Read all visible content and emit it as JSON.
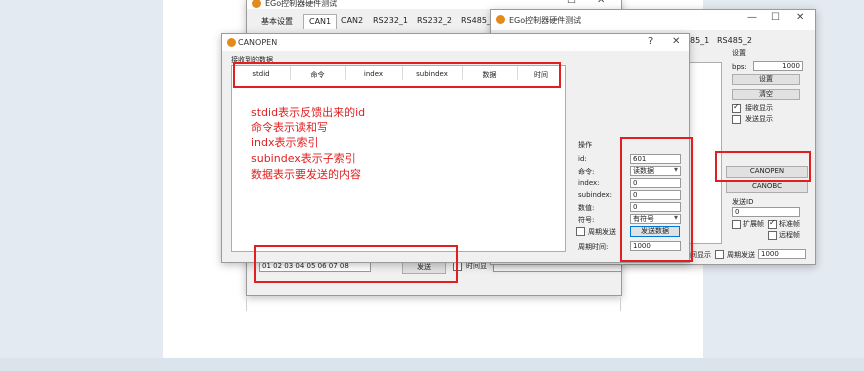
{
  "back_window": {
    "title": "EGo控制器硬件测试",
    "tabs": [
      "基本设置",
      "CAN1",
      "CAN2",
      "RS232_1",
      "RS232_2",
      "RS485_1"
    ],
    "data_input_value": "01 02 03 04 05 06 07 08",
    "send_label": "发送",
    "time_label": "时间显"
  },
  "right_window": {
    "title": "EGo控制器硬件测试",
    "tabs_partial": [
      "85_1",
      "RS485_2"
    ],
    "settings_label": "设置",
    "bps_label": "bps:",
    "bps_value": "1000",
    "set_button": "设置",
    "clear_button": "清空",
    "recv_show_label": "接收显示",
    "send_show_label": "发送显示",
    "canopen_button": "CANOPEN",
    "canobc_button": "CANOBC",
    "send_id_label": "发送ID",
    "send_id_value": "0",
    "ext_frame_label": "扩展帧",
    "std_frame_label": "标准帧",
    "remote_frame_label": "远程帧",
    "show_partial": "间显示",
    "periodic_send_label": "周期发送",
    "periodic_value": "1000"
  },
  "canopen_dialog": {
    "title": "CANOPEN",
    "help": "?",
    "close": "✕",
    "recv_message_label": "接收到的数据",
    "columns": [
      "stdid",
      "命令",
      "index",
      "subindex",
      "数据",
      "时间"
    ],
    "annotation_lines": [
      "stdid表示反馈出来的id",
      "命令表示读和写",
      "indx表示索引",
      "subindex表示子索引",
      "数据表示要发送的内容"
    ],
    "ops": {
      "group_label": "操作",
      "id_label": "id:",
      "id_value": "601",
      "cmd_label": "命令:",
      "cmd_value": "读数据",
      "index_label": "index:",
      "index_value": "0",
      "subindex_label": "subindex:",
      "subindex_value": "0",
      "value_label": "数值:",
      "value_value": "0",
      "sign_label": "符号:",
      "sign_value": "有符号",
      "periodic_label": "周期发送",
      "send_data_button": "发送数据",
      "period_time_label": "周期时间:",
      "period_time_value": "1000"
    }
  },
  "colors": {
    "annotation": "#e02020",
    "accent": "#0078d7",
    "window_bg": "#f0f0f0"
  }
}
